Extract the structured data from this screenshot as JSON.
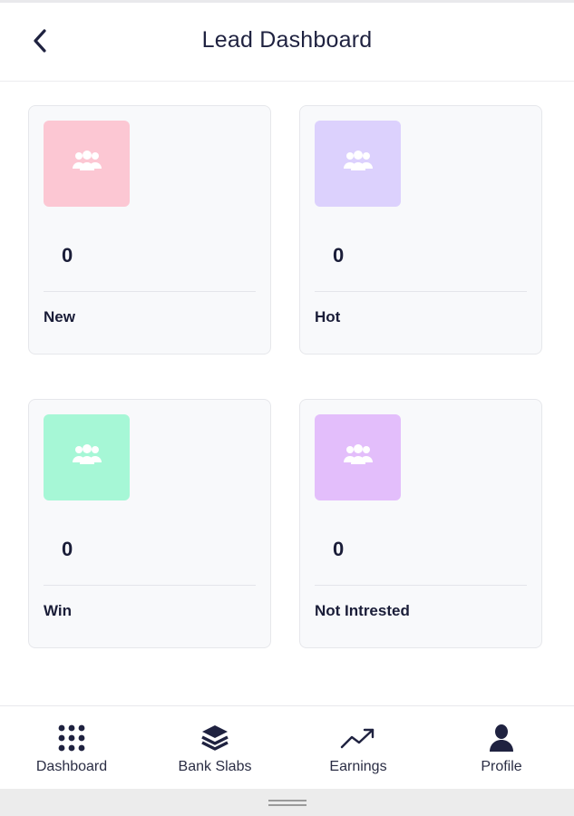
{
  "header": {
    "title": "Lead Dashboard",
    "back_icon": "chevron-left-icon"
  },
  "cards": [
    {
      "count": "0",
      "label": "New",
      "color": "#fcc7d3",
      "icon": "users-icon"
    },
    {
      "count": "0",
      "label": "Hot",
      "color": "#dcd1fd",
      "icon": "users-icon"
    },
    {
      "count": "0",
      "label": "Win",
      "color": "#a6f7d6",
      "icon": "users-icon"
    },
    {
      "count": "0",
      "label": "Not Intrested",
      "color": "#e3befb",
      "icon": "users-icon"
    }
  ],
  "bottom_nav": [
    {
      "label": "Dashboard",
      "icon": "grid-icon"
    },
    {
      "label": "Bank Slabs",
      "icon": "layers-icon"
    },
    {
      "label": "Earnings",
      "icon": "trending-up-icon"
    },
    {
      "label": "Profile",
      "icon": "user-icon"
    }
  ]
}
